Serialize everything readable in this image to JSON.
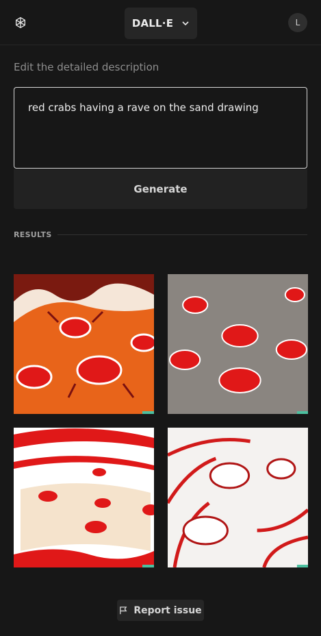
{
  "header": {
    "model_label": "DALL·E",
    "avatar_initial": "L"
  },
  "prompt": {
    "label": "Edit the detailed description",
    "text": "red crabs having a rave on the sand drawing"
  },
  "generate_label": "Generate",
  "results": {
    "label": "RESULTS",
    "images": [
      "red crabs on orange sand",
      "red crabs on gray sand",
      "red crabs on white and red waves",
      "red crab outlines in white sand"
    ]
  },
  "report_label": "Report issue",
  "colors": {
    "background": "#171717",
    "surface": "#262626",
    "text": "#ececec",
    "muted": "#8e8e8e",
    "crab_red": "#e01818"
  }
}
